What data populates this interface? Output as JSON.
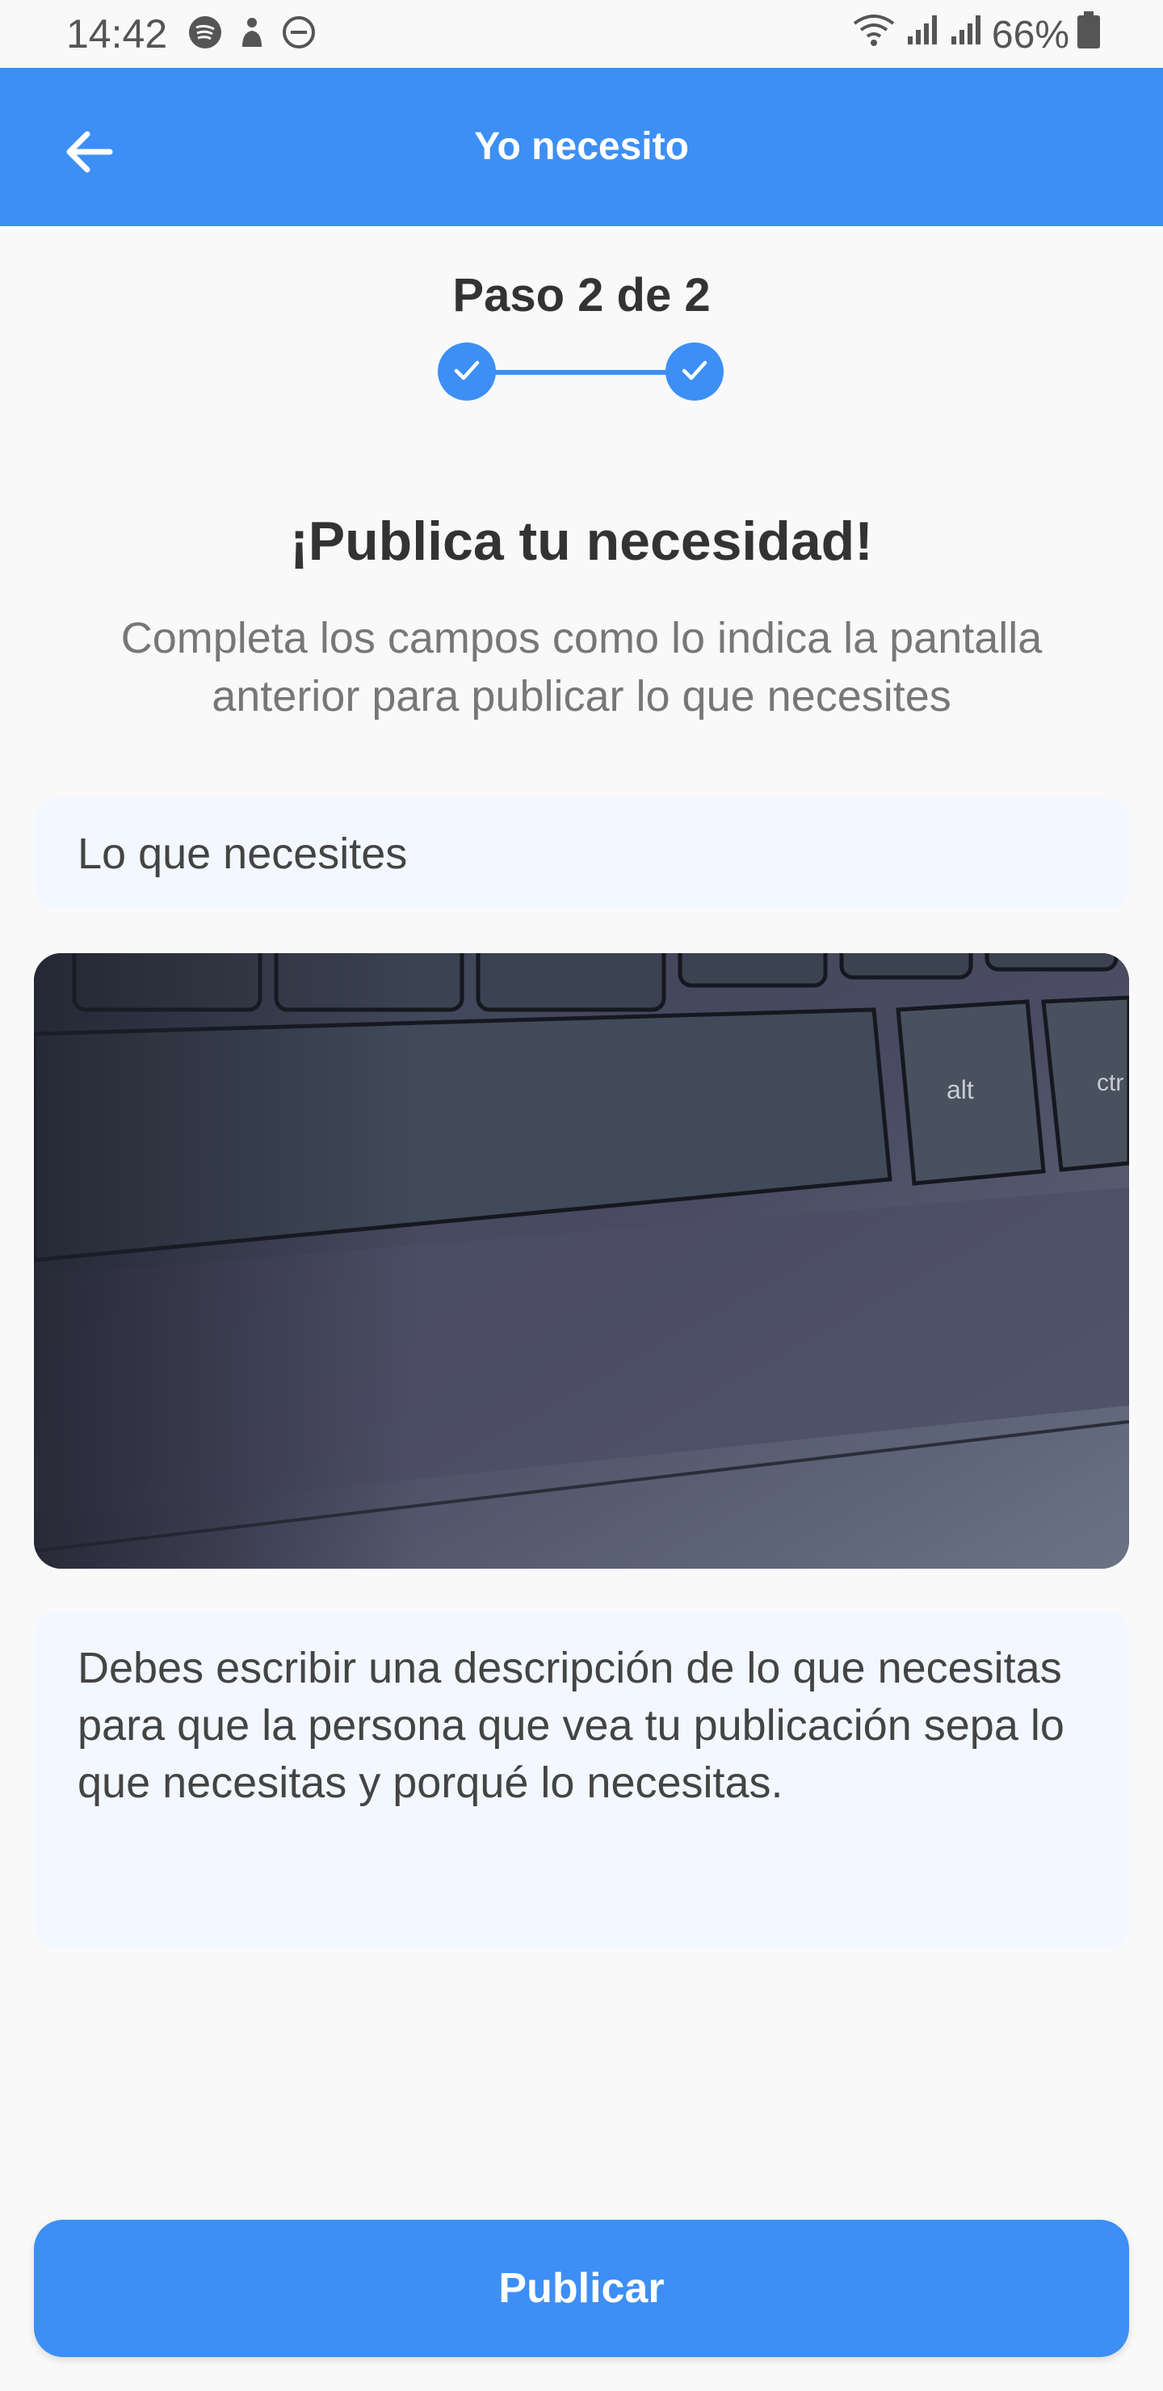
{
  "status_bar": {
    "time": "14:42",
    "battery": "66%",
    "icons": [
      "spotify-icon",
      "notification-icon",
      "do-not-disturb-icon",
      "wifi-icon",
      "signal-icon",
      "signal-icon",
      "battery-icon"
    ]
  },
  "app_bar": {
    "title": "Yo necesito",
    "back_icon": "arrow-left-icon"
  },
  "stepper": {
    "label": "Paso 2 de 2",
    "steps_completed": 2,
    "steps_total": 2
  },
  "main": {
    "headline": "¡Publica tu necesidad!",
    "subhead": "Completa los campos como lo indica la pantalla anterior para publicar lo que necesites",
    "title_field": {
      "placeholder": "Lo que necesites"
    },
    "photo": {
      "description": "keyboard-photo"
    },
    "description_field": {
      "placeholder": "Debes escribir una descripción de lo que necesitas para que la persona que vea tu publicación sepa lo que necesitas y porqué lo necesitas."
    }
  },
  "actions": {
    "publish_label": "Publicar"
  },
  "colors": {
    "primary": "#3d8ff5",
    "background": "#f9f9f9",
    "field_background": "#f3f7ff",
    "heading_text": "#333333",
    "muted_text": "#777777"
  }
}
